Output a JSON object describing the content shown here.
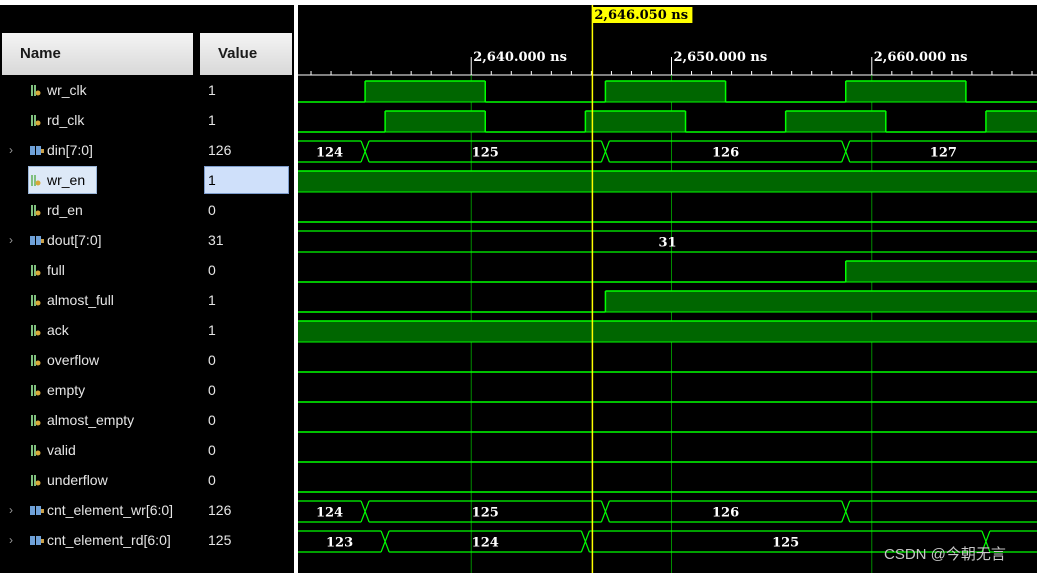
{
  "columns": {
    "name": "Name",
    "value": "Value"
  },
  "cursor": {
    "label": "2,646.050 ns",
    "time_ns": 2646.05,
    "color": "#ffff00"
  },
  "time_axis": {
    "start_ns": 2631.35,
    "end_ns": 2668.25,
    "ticks": [
      {
        "time_ns": 2640.0,
        "label": "2,640.000 ns"
      },
      {
        "time_ns": 2650.0,
        "label": "2,650.000 ns"
      },
      {
        "time_ns": 2660.0,
        "label": "2,660.000 ns"
      }
    ]
  },
  "colors": {
    "wave": "#00ff00",
    "wave_fill": "#006600",
    "cursor": "#ffff00",
    "bus_text": "#ffffff"
  },
  "signals": [
    {
      "name": "wr_clk",
      "value": "1",
      "kind": "bit",
      "icon": "bit-signal-icon",
      "wave": [
        [
          2631.35,
          0
        ],
        [
          2634.7,
          1
        ],
        [
          2640.7,
          0
        ],
        [
          2646.7,
          1
        ],
        [
          2652.7,
          0
        ],
        [
          2658.7,
          1
        ],
        [
          2664.7,
          0
        ]
      ]
    },
    {
      "name": "rd_clk",
      "value": "1",
      "kind": "bit",
      "icon": "bit-signal-icon",
      "wave": [
        [
          2631.35,
          0
        ],
        [
          2635.7,
          1
        ],
        [
          2640.7,
          0
        ],
        [
          2645.7,
          1
        ],
        [
          2650.7,
          0
        ],
        [
          2655.7,
          1
        ],
        [
          2660.7,
          0
        ],
        [
          2665.7,
          1
        ]
      ]
    },
    {
      "name": "din[7:0]",
      "value": "126",
      "kind": "bus",
      "icon": "bus-signal-icon",
      "expandable": true,
      "segments": [
        [
          "124",
          2631.35
        ],
        [
          "125",
          2634.7
        ],
        [
          "126",
          2646.7
        ],
        [
          "127",
          2658.7
        ]
      ]
    },
    {
      "name": "wr_en",
      "value": "1",
      "kind": "bit",
      "icon": "bit-signal-icon",
      "selected": true,
      "wave": [
        [
          2631.35,
          1
        ]
      ]
    },
    {
      "name": "rd_en",
      "value": "0",
      "kind": "bit",
      "icon": "bit-signal-icon",
      "wave": [
        [
          2631.35,
          0
        ]
      ]
    },
    {
      "name": "dout[7:0]",
      "value": "31",
      "kind": "bus",
      "icon": "bus-signal-icon",
      "expandable": true,
      "segments": [
        [
          "31",
          2631.35
        ]
      ]
    },
    {
      "name": "full",
      "value": "0",
      "kind": "bit",
      "icon": "bit-signal-icon",
      "wave": [
        [
          2631.35,
          0
        ],
        [
          2658.7,
          1
        ]
      ]
    },
    {
      "name": "almost_full",
      "value": "1",
      "kind": "bit",
      "icon": "bit-signal-icon",
      "wave": [
        [
          2631.35,
          0
        ],
        [
          2646.7,
          1
        ]
      ]
    },
    {
      "name": "ack",
      "value": "1",
      "kind": "bit",
      "icon": "bit-signal-icon",
      "wave": [
        [
          2631.35,
          1
        ]
      ]
    },
    {
      "name": "overflow",
      "value": "0",
      "kind": "bit",
      "icon": "bit-signal-icon",
      "wave": [
        [
          2631.35,
          0
        ]
      ]
    },
    {
      "name": "empty",
      "value": "0",
      "kind": "bit",
      "icon": "bit-signal-icon",
      "wave": [
        [
          2631.35,
          0
        ]
      ]
    },
    {
      "name": "almost_empty",
      "value": "0",
      "kind": "bit",
      "icon": "bit-signal-icon",
      "wave": [
        [
          2631.35,
          0
        ]
      ]
    },
    {
      "name": "valid",
      "value": "0",
      "kind": "bit",
      "icon": "bit-signal-icon",
      "wave": [
        [
          2631.35,
          0
        ]
      ]
    },
    {
      "name": "underflow",
      "value": "0",
      "kind": "bit",
      "icon": "bit-signal-icon",
      "wave": [
        [
          2631.35,
          0
        ]
      ]
    },
    {
      "name": "cnt_element_wr[6:0]",
      "value": "126",
      "kind": "bus",
      "icon": "bus-signal-icon",
      "expandable": true,
      "segments": [
        [
          "124",
          2631.35
        ],
        [
          "125",
          2634.7
        ],
        [
          "126",
          2646.7
        ],
        [
          "",
          2658.7
        ]
      ]
    },
    {
      "name": "cnt_element_rd[6:0]",
      "value": "125",
      "kind": "bus",
      "icon": "bus-signal-icon",
      "expandable": true,
      "segments": [
        [
          "123",
          2631.35
        ],
        [
          "124",
          2635.7
        ],
        [
          "125",
          2645.7
        ],
        [
          "",
          2665.7
        ]
      ]
    }
  ],
  "watermark": "CSDN @今朝无言"
}
